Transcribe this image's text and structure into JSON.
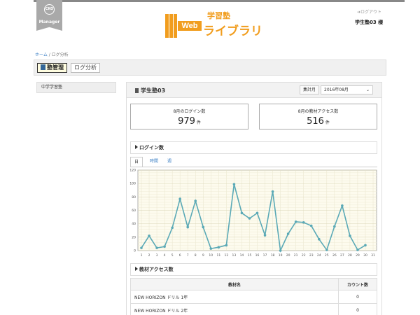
{
  "header": {
    "manager_badge": {
      "circle_text": "CKO",
      "label": "Manager"
    },
    "logo": {
      "web": "Web",
      "sub": "学習塾",
      "main": "ライブラリ"
    },
    "logout": "ログアウト",
    "user_name": "学生塾03 様"
  },
  "breadcrumb": {
    "home": "ホーム",
    "separator": " / ",
    "current": "ログ分析"
  },
  "nav": {
    "tabs": [
      {
        "label": "塾管理",
        "active": true
      },
      {
        "label": "ログ分析",
        "active": false
      }
    ]
  },
  "sidebar": {
    "items": [
      {
        "label": "中学学習塾"
      }
    ]
  },
  "panel": {
    "title": "学生塾03",
    "period_label": "集計月",
    "period_value": "2016年08月",
    "stats": [
      {
        "label": "8月のログイン数",
        "value": "979",
        "unit": "件"
      },
      {
        "label": "8月の教材アクセス数",
        "value": "516",
        "unit": "件"
      }
    ],
    "login_section_title": "ログイン数",
    "chart_tabs": [
      {
        "label": "日",
        "active": true
      },
      {
        "label": "時間",
        "active": false
      },
      {
        "label": "週",
        "active": false
      }
    ],
    "material_section_title": "教材アクセス数",
    "table": {
      "headers": [
        "教材名",
        "カウント数"
      ],
      "rows": [
        {
          "name": "NEW HORIZON ドリル 1年",
          "count": "0"
        },
        {
          "name": "NEW HORIZON ドリル 2年",
          "count": "0"
        }
      ]
    }
  },
  "colors": {
    "accent": "#f19d1e",
    "line": "#5aa9b6",
    "chart_bg": "#fdfbee",
    "link": "#3b7fc4"
  },
  "chart_data": {
    "type": "line",
    "title": "",
    "xlabel": "",
    "ylabel": "",
    "x": [
      1,
      2,
      3,
      4,
      5,
      6,
      7,
      8,
      9,
      10,
      11,
      12,
      13,
      14,
      15,
      16,
      17,
      18,
      19,
      20,
      21,
      22,
      23,
      24,
      25,
      26,
      27,
      28,
      29,
      30,
      31
    ],
    "series": [
      {
        "values": [
          4,
          22,
          4,
          6,
          34,
          77,
          35,
          74,
          35,
          3,
          5,
          8,
          99,
          56,
          48,
          56,
          23,
          88,
          0,
          25,
          43,
          42,
          37,
          17,
          1,
          36,
          67,
          22,
          1,
          8,
          null
        ]
      }
    ],
    "ylim": [
      0,
      120
    ],
    "yticks": [
      0,
      20,
      40,
      60,
      80,
      100,
      120
    ],
    "grid": true
  }
}
